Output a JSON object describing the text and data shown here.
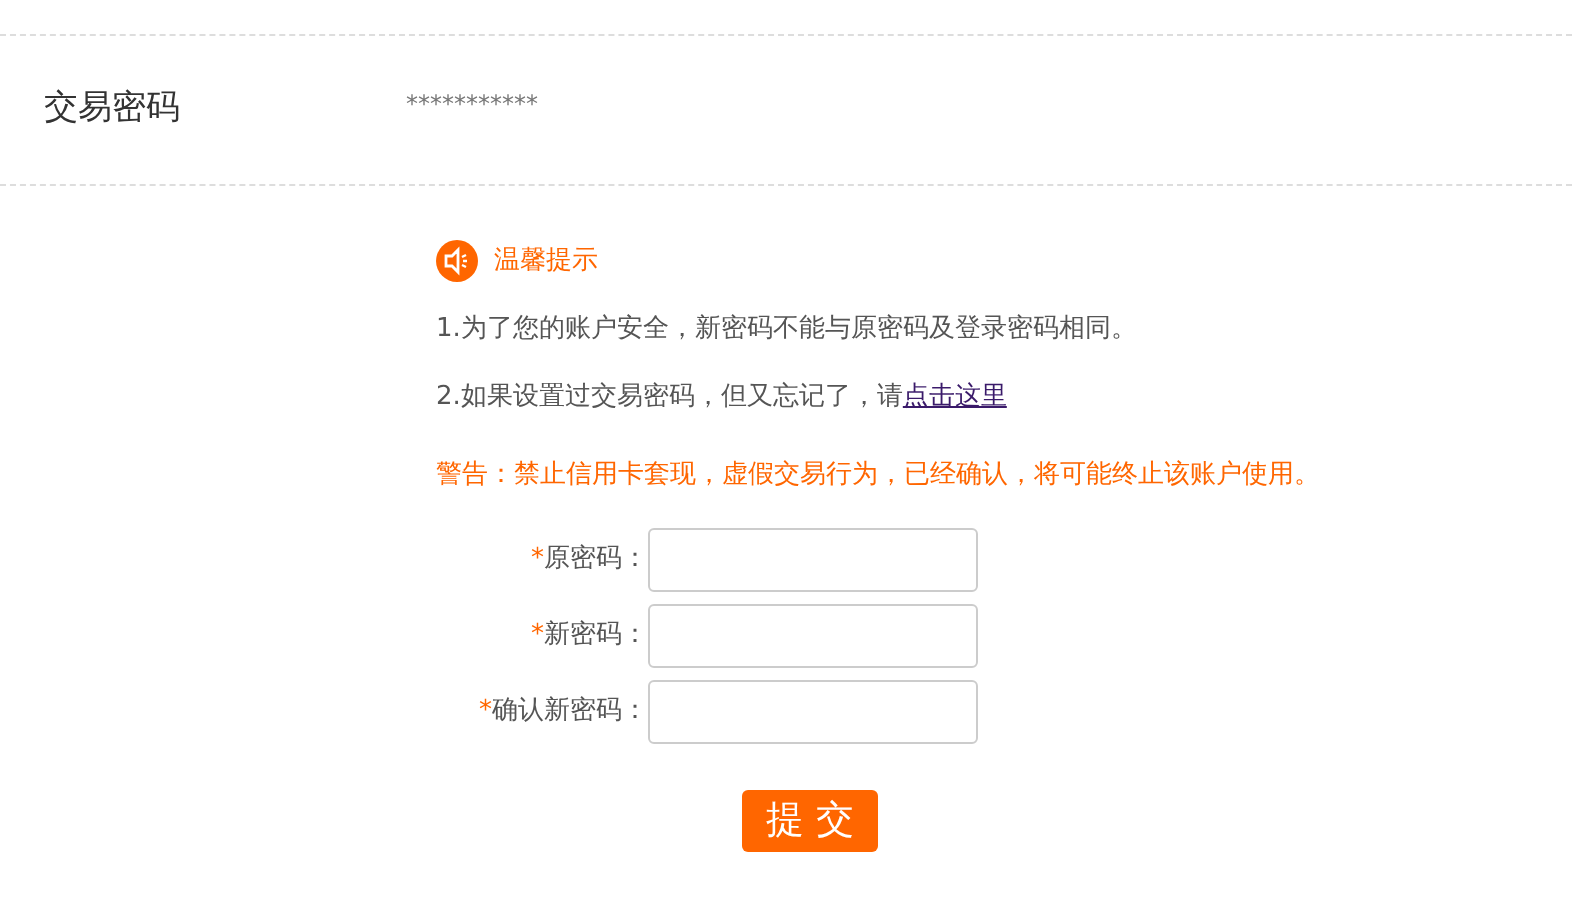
{
  "setting_row": {
    "label": "交易密码",
    "value": "***********"
  },
  "notice": {
    "title": "温馨提示",
    "lines": [
      {
        "text": "1.为了您的账户安全，新密码不能与原密码及登录密码相同。"
      },
      {
        "text": "2.如果设置过交易密码，但又忘记了，请",
        "link": "点击这里"
      }
    ]
  },
  "warning": "警告：禁止信用卡套现，虚假交易行为，已经确认，将可能终止该账户使用。",
  "fields": [
    {
      "required_mark": "*",
      "label": "原密码："
    },
    {
      "required_mark": "*",
      "label": "新密码："
    },
    {
      "required_mark": "*",
      "label": "确认新密码："
    }
  ],
  "submit": "提 交"
}
